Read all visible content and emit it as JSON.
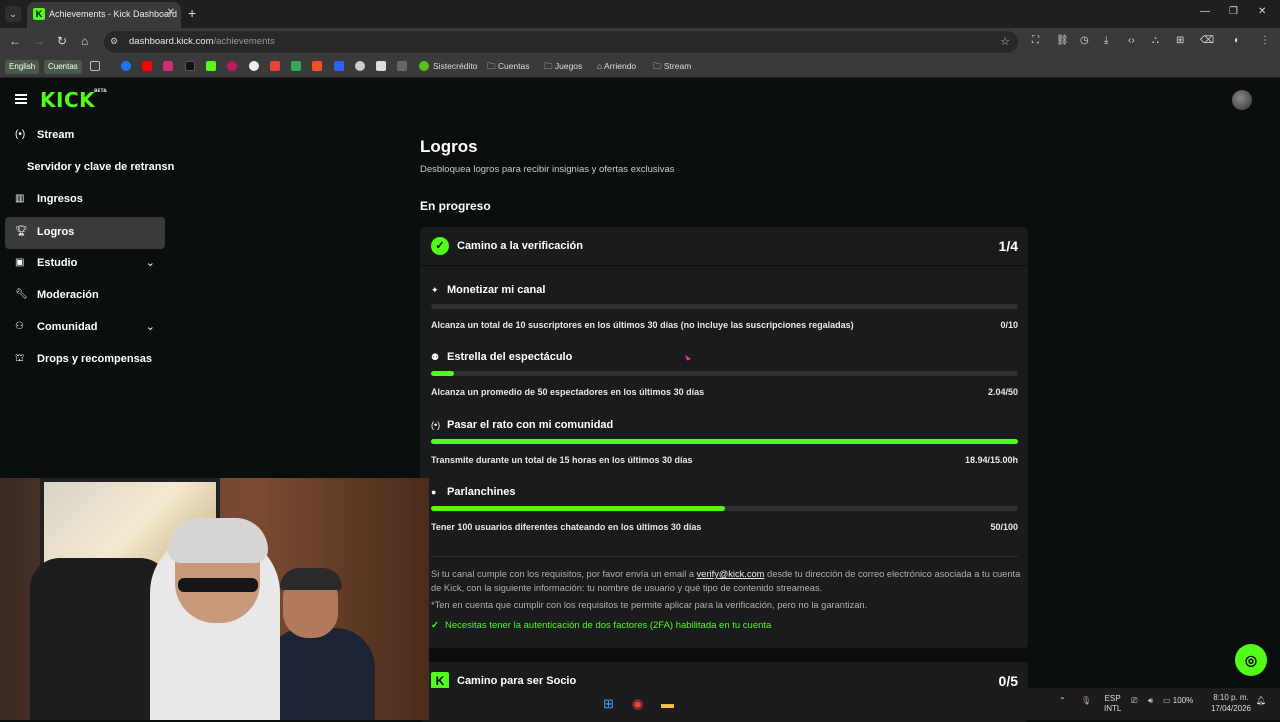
{
  "browser": {
    "tab_title": "Achievements - Kick Dashboard",
    "url_host": "dashboard.kick.com",
    "url_path": "/achievements",
    "bookmarks": {
      "english": "English",
      "cuentas_chip": "Cuentas",
      "sistecredito": "Sistecrédito",
      "cuentas": "Cuentas",
      "juegos": "Juegos",
      "arriendo": "Arriendo",
      "stream": "Stream"
    }
  },
  "logo": {
    "text": "KICK",
    "badge": "BETA"
  },
  "sidebar": {
    "items": [
      {
        "label": "Stream"
      },
      {
        "label": "Servidor y clave de retransn"
      },
      {
        "label": "Ingresos"
      },
      {
        "label": "Logros"
      },
      {
        "label": "Estudio"
      },
      {
        "label": "Moderación"
      },
      {
        "label": "Comunidad"
      },
      {
        "label": "Drops y recompensas"
      }
    ]
  },
  "page": {
    "title": "Logros",
    "subtitle": "Desbloquea logros para recibir insignias y ofertas exclusivas",
    "section": "En progreso"
  },
  "verification_card": {
    "title": "Camino a la verificación",
    "count": "1/4",
    "tasks": [
      {
        "name": "Monetizar mi canal",
        "desc": "Alcanza un total de 10 suscriptores en los últimos 30 días (no incluye las suscripciones regaladas)",
        "value": "0/10",
        "progress": 0.0
      },
      {
        "name": "Estrella del espectáculo",
        "desc": "Alcanza un promedio de 50 espectadores en los últimos 30 días",
        "value": "2.04/50",
        "progress": 0.04
      },
      {
        "name": "Pasar el rato con mi comunidad",
        "desc": "Transmite durante un total de 15 horas en los últimos 30 días",
        "value": "18.94/15.00h",
        "progress": 1.0
      },
      {
        "name": "Parlanchines",
        "desc": "Tener 100 usuarios diferentes chateando en los últimos 30 días",
        "value": "50/100",
        "progress": 0.5
      }
    ],
    "note_before": "Si tu canal cumple con los requisitos, por favor envía un email a ",
    "note_email": "verify@kick.com",
    "note_after": " desde tu dirección de correo electrónico asociada a tu cuenta de Kick, con la siguiente información: tu nombre de usuario y qué tipo de contenido streameas.",
    "note2": "*Ten en cuenta que cumplir con los requisitos te permite aplicar para la verificación, pero no la garantizan.",
    "check": "Necesitas tener la autenticación de dos factores (2FA) habilitada en tu cuenta"
  },
  "partner_card": {
    "title": "Camino para ser Socio",
    "count": "0/5"
  },
  "taskbar": {
    "lang": "ESP",
    "layout": "INTL",
    "battery": "100%",
    "time": "8:10 p. m.",
    "date": "17/04/2026"
  },
  "colors": {
    "accent": "#53fc18",
    "bg": "#0b0e0f",
    "card": "#191b1c"
  }
}
